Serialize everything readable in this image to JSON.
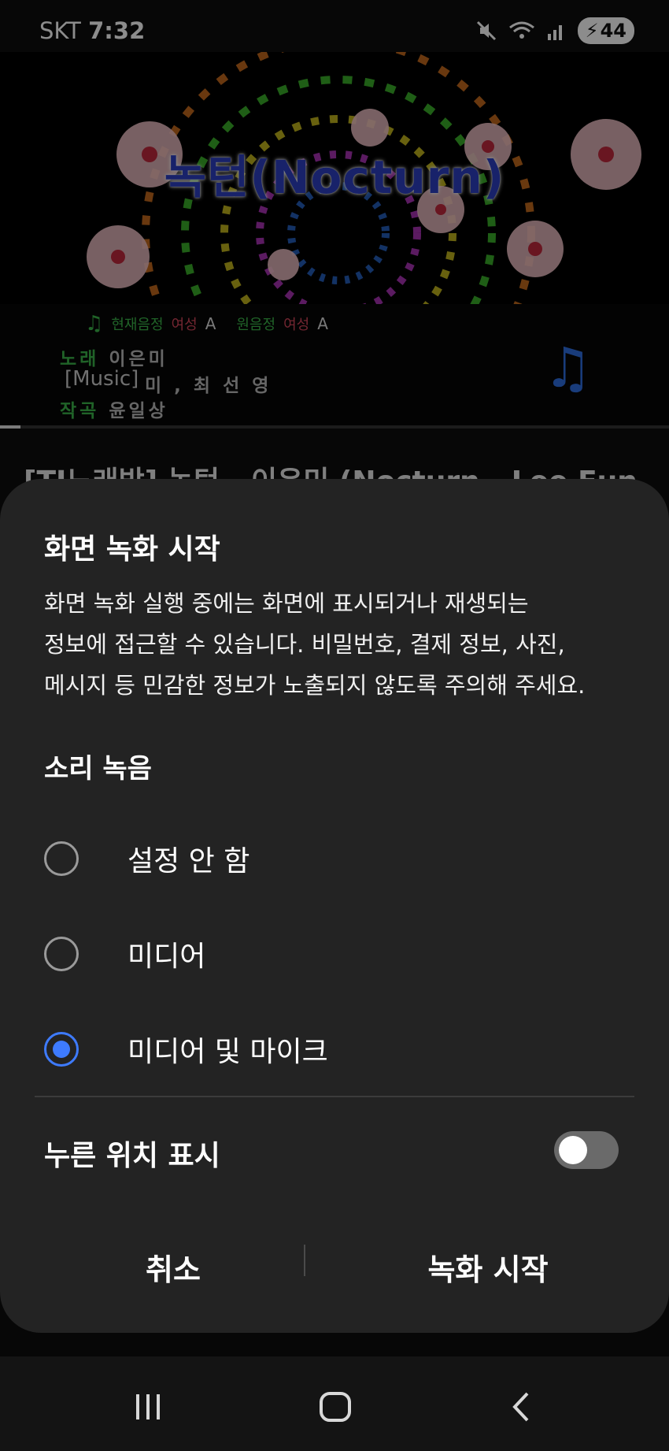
{
  "status_bar": {
    "carrier": "SKT",
    "time": "7:32",
    "battery": "44",
    "icons": [
      "mute-icon",
      "wifi-icon",
      "signal-icon",
      "battery-charging-icon"
    ]
  },
  "background": {
    "video_title": "녹턴(Nocturn)",
    "current_key_label": "현재음정",
    "current_key_value": "여성",
    "current_key_note": "A",
    "original_key_label": "원음정",
    "original_key_value": "여성",
    "original_key_note": "A",
    "singer_label": "노래",
    "singer": "이은미",
    "lyricist": "미 , 최 선 영",
    "composer_label": "작곡",
    "composer": "윤일상",
    "music_caption": "[Music]",
    "page_title": "[TJ노래방] 녹턴 - 이은미 (Nocturn - Lee Eun"
  },
  "dialog": {
    "title": "화면 녹화 시작",
    "body_lines": [
      "화면 녹화 실행 중에는 화면에 표시되거나 재생되는",
      "정보에 접근할 수 있습니다. 비밀번호, 결제 정보, 사진,",
      "메시지 등 민감한 정보가 노출되지 않도록 주의해 주세요."
    ],
    "sound_section_title": "소리 녹음",
    "options": [
      {
        "label": "설정 안 함",
        "selected": false
      },
      {
        "label": "미디어",
        "selected": false
      },
      {
        "label": "미디어 및 마이크",
        "selected": true
      }
    ],
    "show_touches_label": "누른 위치 표시",
    "show_touches_on": false,
    "cancel_label": "취소",
    "start_label": "녹화 시작",
    "accent_color": "#3e7bff"
  },
  "navbar": {
    "icons": [
      "recent-apps-icon",
      "home-icon",
      "back-icon"
    ]
  }
}
